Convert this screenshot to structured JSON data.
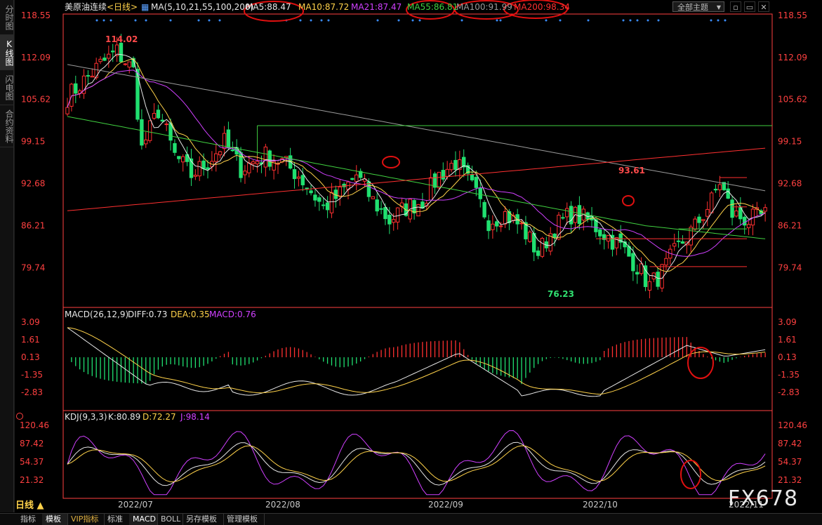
{
  "left_tabs": [
    {
      "label": "分时图",
      "active": false
    },
    {
      "label": "K线图",
      "active": true
    },
    {
      "label": "闪电图",
      "active": false
    },
    {
      "label": "合约资料",
      "active": false
    }
  ],
  "header": {
    "symbol": "美原油连续",
    "period": "<日线>",
    "ma_label": "MA(5,10,21,55,100,200)",
    "indicators": [
      {
        "text": "MA5:88.47",
        "color": "#e8e8e8"
      },
      {
        "text": "MA10:87.72",
        "color": "#ffd24a"
      },
      {
        "text": "MA21:87.47",
        "color": "#d040ff"
      },
      {
        "text": "MA55:86.81",
        "color": "#40d040"
      },
      {
        "text": "MA100:91.99",
        "color": "#9a9a9a"
      },
      {
        "text": "MA200:98.34",
        "color": "#ff3030"
      }
    ],
    "theme_select": "全部主题",
    "window_buttons": [
      "▫",
      "▭",
      "✕"
    ]
  },
  "main_panel": {
    "y_ticks": [
      "118.55",
      "112.09",
      "105.62",
      "99.15",
      "92.68",
      "86.21",
      "79.74"
    ],
    "annotations": [
      "114.02",
      "93.61",
      "76.23"
    ]
  },
  "macd_panel": {
    "title": "MACD(26,12,9)",
    "diff": "DIFF:0.73",
    "dea": "DEA:0.35",
    "macd": "MACD:0.76",
    "y_ticks": [
      "3.09",
      "1.61",
      "0.13",
      "-1.35",
      "-2.83"
    ]
  },
  "kdj_panel": {
    "title": "KDJ(9,3,3)",
    "k": "K:80.89",
    "d": "D:72.27",
    "j": "J:98.14",
    "y_ticks": [
      "120.46",
      "87.42",
      "54.37",
      "21.32"
    ]
  },
  "x_axis": [
    "2022/07",
    "2022/08",
    "2022/09",
    "2022/10",
    "2022/11"
  ],
  "period_label": "日线 ▲",
  "bottom_tabs": [
    {
      "label": "指标",
      "active": false
    },
    {
      "label": "模板",
      "active": true
    },
    {
      "label": "VIP指标",
      "active": false,
      "vip": true
    },
    {
      "label": "标准",
      "active": false
    },
    {
      "label": "MACD",
      "active": true
    },
    {
      "label": "BOLL",
      "active": false
    },
    {
      "label": "另存模板",
      "active": false
    },
    {
      "label": "管理模板",
      "active": false
    }
  ],
  "watermark": "FX678",
  "colors": {
    "up": "#ff3030",
    "down": "#20e070",
    "bg": "#000000",
    "axis": "#ff4040"
  }
}
